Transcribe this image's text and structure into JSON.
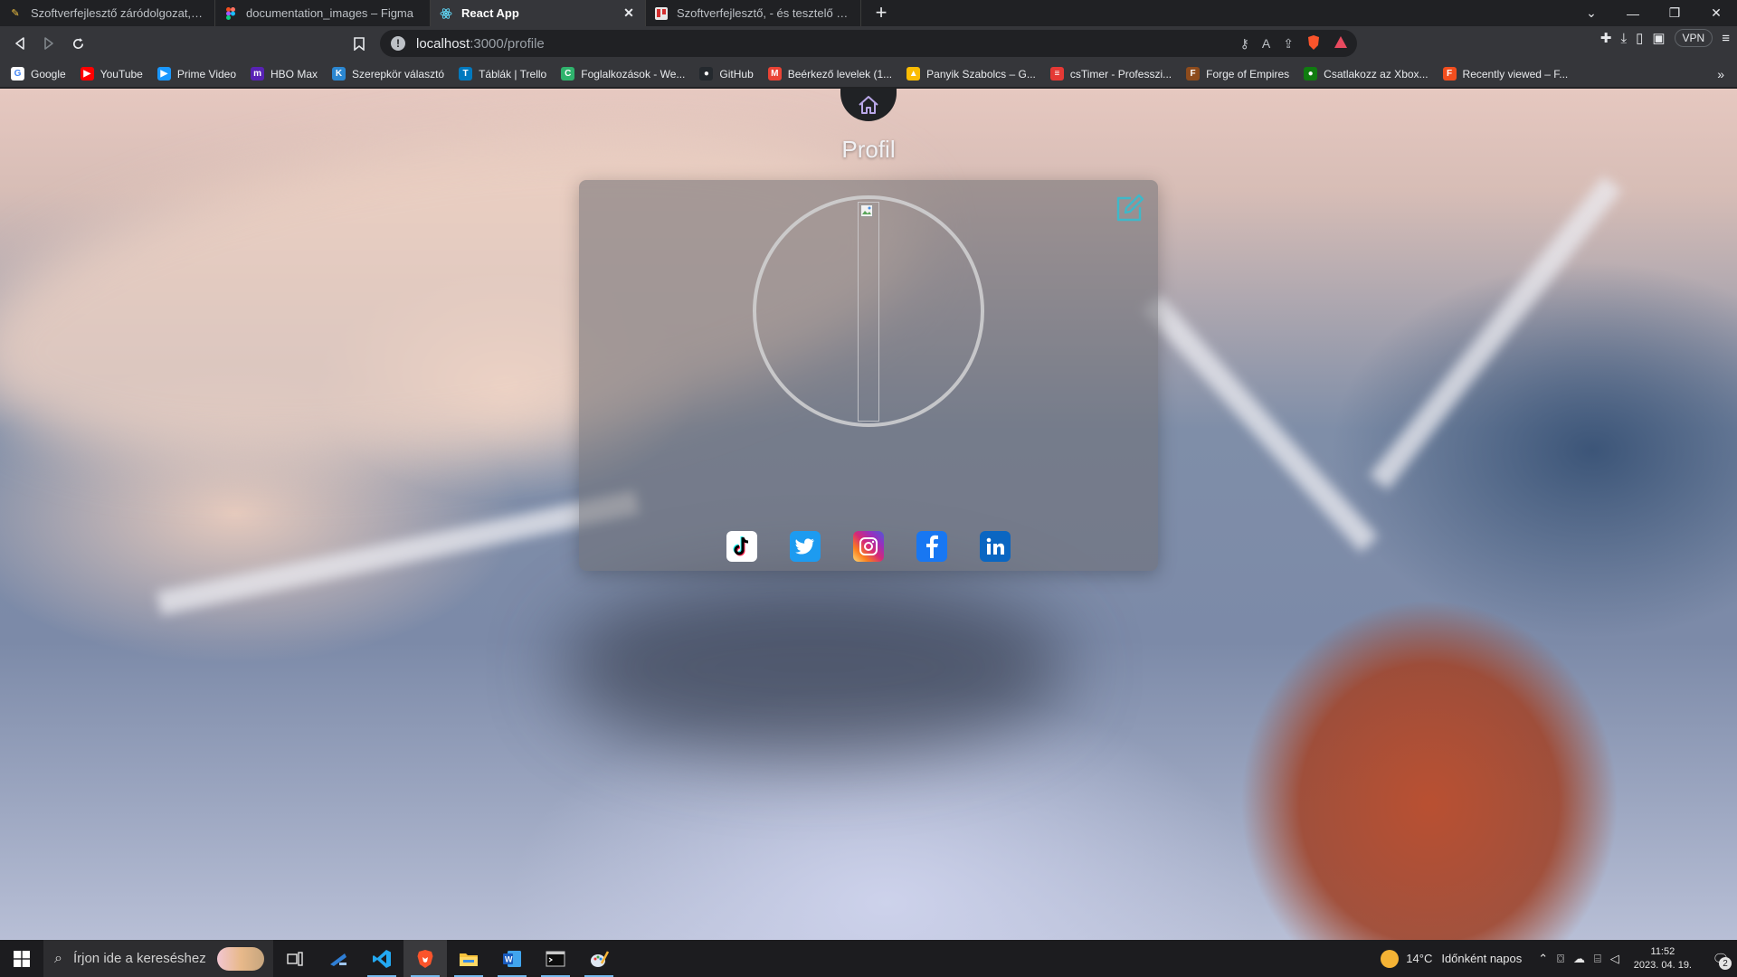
{
  "browser": {
    "tabs": [
      {
        "title": "Szoftverfejlesztő záródolgozat, vizsgat",
        "icon": "pencil-icon",
        "active": false
      },
      {
        "title": "documentation_images – Figma",
        "icon": "figma-icon",
        "active": false
      },
      {
        "title": "React App",
        "icon": "react-icon",
        "active": true
      },
      {
        "title": "Szoftverfejlesztő, - és tesztelő projektm",
        "icon": "trello-icon",
        "active": false
      }
    ],
    "new_tab": "+",
    "url_host": "localhost",
    "url_path": ":3000/profile",
    "vpn_label": "VPN",
    "bookmarks": [
      {
        "label": "Google",
        "color": "#ffffff",
        "glyph": "G"
      },
      {
        "label": "YouTube",
        "color": "#ff0000",
        "glyph": "▶"
      },
      {
        "label": "Prime Video",
        "color": "#1a98ff",
        "glyph": "▶"
      },
      {
        "label": "HBO Max",
        "color": "#5822b4",
        "glyph": "m"
      },
      {
        "label": "Szerepkör választó",
        "color": "#2b87d1",
        "glyph": "K"
      },
      {
        "label": "Táblák | Trello",
        "color": "#0079bf",
        "glyph": "T"
      },
      {
        "label": "Foglalkozások - We...",
        "color": "#2fb36d",
        "glyph": "C"
      },
      {
        "label": "GitHub",
        "color": "#24292e",
        "glyph": "●"
      },
      {
        "label": "Beérkező levelek (1...",
        "color": "#ea4335",
        "glyph": "M"
      },
      {
        "label": "Panyik Szabolcs – G...",
        "color": "#fbbc04",
        "glyph": "▲"
      },
      {
        "label": "csTimer - Professzi...",
        "color": "#e53935",
        "glyph": "≡"
      },
      {
        "label": "Forge of Empires",
        "color": "#8d4b1c",
        "glyph": "F"
      },
      {
        "label": "Csatlakozz az Xbox...",
        "color": "#107c10",
        "glyph": "●"
      },
      {
        "label": "Recently viewed – F...",
        "color": "#f24e1e",
        "glyph": "F"
      }
    ]
  },
  "page": {
    "title": "Profil",
    "socials": [
      "TikTok",
      "Twitter",
      "Instagram",
      "Facebook",
      "LinkedIn"
    ],
    "accent": "#3fb8c8"
  },
  "taskbar": {
    "search_placeholder": "Írjon ide a kereséshez",
    "weather_temp": "14°C",
    "weather_text": "Időnként napos",
    "time": "11:52",
    "date": "2023. 04. 19.",
    "notification_count": "2"
  }
}
